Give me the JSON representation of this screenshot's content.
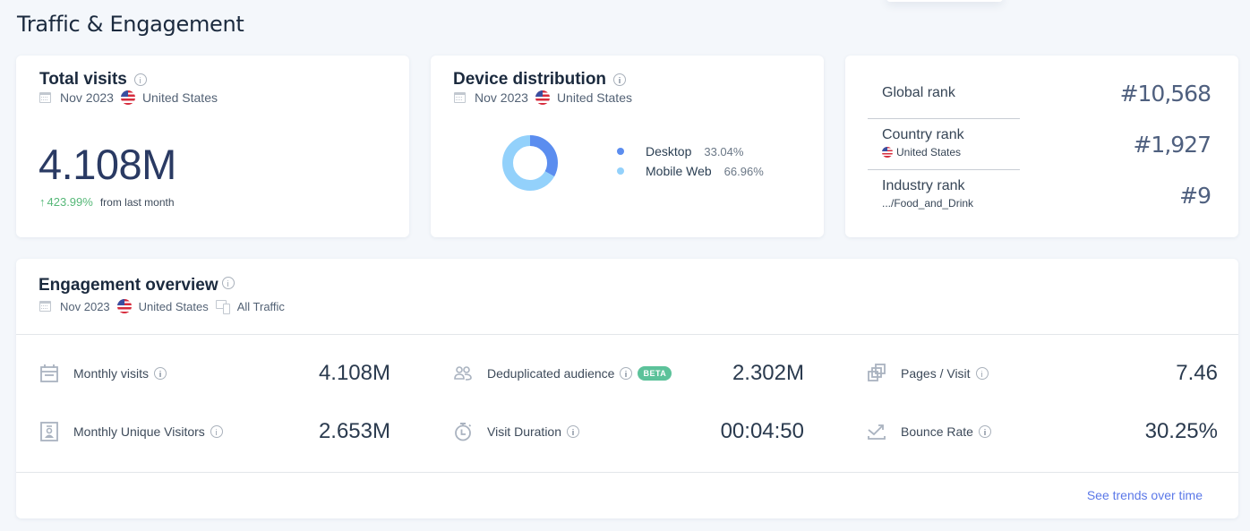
{
  "page": {
    "title": "Traffic & Engagement"
  },
  "total_visits": {
    "title": "Total visits",
    "date": "Nov 2023",
    "country": "United States",
    "value": "4.108M",
    "change_arrow": "↑",
    "change_pct": "423.99%",
    "change_label": "from last month",
    "change_color": "#56b878"
  },
  "device_distribution": {
    "title": "Device distribution",
    "date": "Nov 2023",
    "country": "United States",
    "segments": [
      {
        "label": "Desktop",
        "value": "33.04%",
        "percent": 33.04,
        "color": "#5b8def"
      },
      {
        "label": "Mobile Web",
        "value": "66.96%",
        "percent": 66.96,
        "color": "#93d1fb"
      }
    ]
  },
  "ranks": [
    {
      "label": "Global rank",
      "sub": "",
      "value": "#10,568"
    },
    {
      "label": "Country rank",
      "sub": "United States",
      "value": "#1,927"
    },
    {
      "label": "Industry rank",
      "sub": ".../Food_and_Drink",
      "value": "#9"
    }
  ],
  "engagement": {
    "title": "Engagement overview",
    "date": "Nov 2023",
    "country": "United States",
    "traffic": "All Traffic",
    "metrics": [
      {
        "label": "Monthly visits",
        "value": "4.108M",
        "icon": "calendar-icon"
      },
      {
        "label": "Monthly Unique Visitors",
        "value": "2.653M",
        "icon": "user-badge-icon"
      },
      {
        "label": "Deduplicated audience",
        "value": "2.302M",
        "icon": "users-icon",
        "badge": "BETA"
      },
      {
        "label": "Visit Duration",
        "value": "00:04:50",
        "icon": "stopwatch-icon"
      },
      {
        "label": "Pages / Visit",
        "value": "7.46",
        "icon": "pages-icon"
      },
      {
        "label": "Bounce Rate",
        "value": "30.25%",
        "icon": "bounce-icon"
      }
    ],
    "see_trends_label": "See trends over time"
  }
}
